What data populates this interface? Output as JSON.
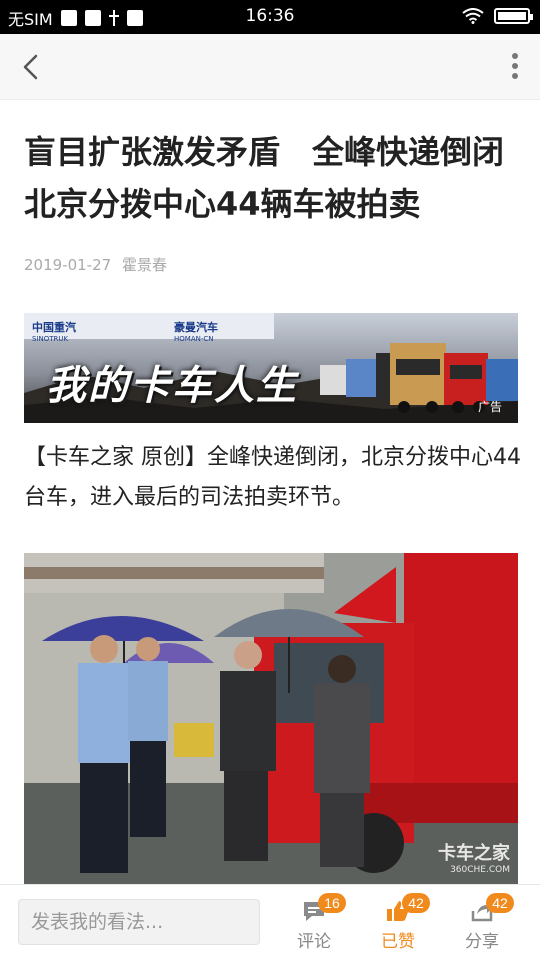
{
  "status_bar": {
    "carrier": "无SIM",
    "time": "16:36"
  },
  "nav": {
    "back_icon": "chevron-left-icon",
    "more_icon": "more-vertical-icon"
  },
  "article": {
    "title": "盲目扩张激发矛盾　全峰快递倒闭 北京分拨中心44辆车被拍卖",
    "date": "2019-01-27",
    "author": "霍景春",
    "ad": {
      "brand_left": "中国重汽",
      "brand_left_en": "SINOTRUK",
      "brand_right": "豪曼汽车",
      "brand_right_en": "HOMAN-CN",
      "slogan": "我的卡车人生",
      "label": "广告"
    },
    "body": "【卡车之家 原创】全峰快递倒闭，北京分拨中心44台车，进入最后的司法拍卖环节。",
    "photo_watermark": "卡车之家",
    "photo_watermark_sub": "360CHE.COM"
  },
  "bottom_bar": {
    "comment_placeholder": "发表我的看法...",
    "actions": [
      {
        "label": "评论",
        "count": "16",
        "icon": "comment-icon",
        "color": "#888888"
      },
      {
        "label": "已赞",
        "count": "42",
        "icon": "thumbs-up-icon",
        "color": "#f08a1c"
      },
      {
        "label": "分享",
        "count": "42",
        "icon": "share-icon",
        "color": "#888888"
      }
    ]
  },
  "colors": {
    "accent": "#f08a1c",
    "badge": "#f08a1c",
    "status_bar_bg": "#000000",
    "nav_bg": "#f7f7f7"
  }
}
